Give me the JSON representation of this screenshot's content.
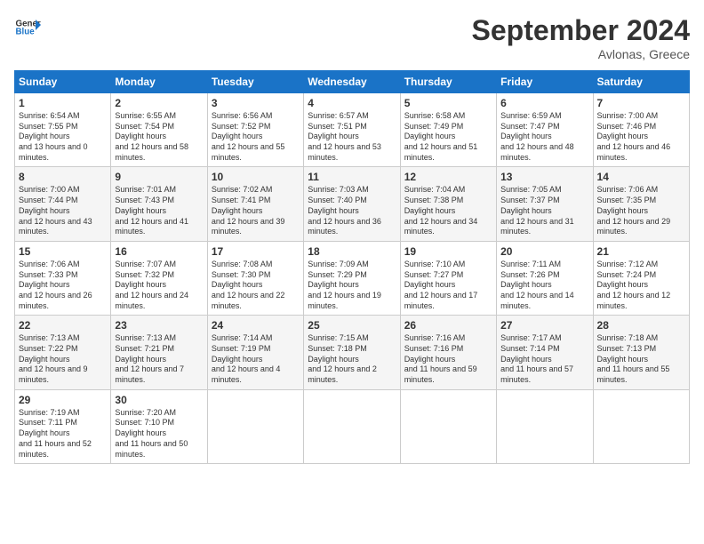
{
  "logo": {
    "text_general": "General",
    "text_blue": "Blue"
  },
  "header": {
    "month": "September 2024",
    "location": "Avlonas, Greece"
  },
  "weekdays": [
    "Sunday",
    "Monday",
    "Tuesday",
    "Wednesday",
    "Thursday",
    "Friday",
    "Saturday"
  ],
  "weeks": [
    [
      {
        "day": "1",
        "sunrise": "6:54 AM",
        "sunset": "7:55 PM",
        "daylight": "13 hours and 0 minutes."
      },
      {
        "day": "2",
        "sunrise": "6:55 AM",
        "sunset": "7:54 PM",
        "daylight": "12 hours and 58 minutes."
      },
      {
        "day": "3",
        "sunrise": "6:56 AM",
        "sunset": "7:52 PM",
        "daylight": "12 hours and 55 minutes."
      },
      {
        "day": "4",
        "sunrise": "6:57 AM",
        "sunset": "7:51 PM",
        "daylight": "12 hours and 53 minutes."
      },
      {
        "day": "5",
        "sunrise": "6:58 AM",
        "sunset": "7:49 PM",
        "daylight": "12 hours and 51 minutes."
      },
      {
        "day": "6",
        "sunrise": "6:59 AM",
        "sunset": "7:47 PM",
        "daylight": "12 hours and 48 minutes."
      },
      {
        "day": "7",
        "sunrise": "7:00 AM",
        "sunset": "7:46 PM",
        "daylight": "12 hours and 46 minutes."
      }
    ],
    [
      {
        "day": "8",
        "sunrise": "7:00 AM",
        "sunset": "7:44 PM",
        "daylight": "12 hours and 43 minutes."
      },
      {
        "day": "9",
        "sunrise": "7:01 AM",
        "sunset": "7:43 PM",
        "daylight": "12 hours and 41 minutes."
      },
      {
        "day": "10",
        "sunrise": "7:02 AM",
        "sunset": "7:41 PM",
        "daylight": "12 hours and 39 minutes."
      },
      {
        "day": "11",
        "sunrise": "7:03 AM",
        "sunset": "7:40 PM",
        "daylight": "12 hours and 36 minutes."
      },
      {
        "day": "12",
        "sunrise": "7:04 AM",
        "sunset": "7:38 PM",
        "daylight": "12 hours and 34 minutes."
      },
      {
        "day": "13",
        "sunrise": "7:05 AM",
        "sunset": "7:37 PM",
        "daylight": "12 hours and 31 minutes."
      },
      {
        "day": "14",
        "sunrise": "7:06 AM",
        "sunset": "7:35 PM",
        "daylight": "12 hours and 29 minutes."
      }
    ],
    [
      {
        "day": "15",
        "sunrise": "7:06 AM",
        "sunset": "7:33 PM",
        "daylight": "12 hours and 26 minutes."
      },
      {
        "day": "16",
        "sunrise": "7:07 AM",
        "sunset": "7:32 PM",
        "daylight": "12 hours and 24 minutes."
      },
      {
        "day": "17",
        "sunrise": "7:08 AM",
        "sunset": "7:30 PM",
        "daylight": "12 hours and 22 minutes."
      },
      {
        "day": "18",
        "sunrise": "7:09 AM",
        "sunset": "7:29 PM",
        "daylight": "12 hours and 19 minutes."
      },
      {
        "day": "19",
        "sunrise": "7:10 AM",
        "sunset": "7:27 PM",
        "daylight": "12 hours and 17 minutes."
      },
      {
        "day": "20",
        "sunrise": "7:11 AM",
        "sunset": "7:26 PM",
        "daylight": "12 hours and 14 minutes."
      },
      {
        "day": "21",
        "sunrise": "7:12 AM",
        "sunset": "7:24 PM",
        "daylight": "12 hours and 12 minutes."
      }
    ],
    [
      {
        "day": "22",
        "sunrise": "7:13 AM",
        "sunset": "7:22 PM",
        "daylight": "12 hours and 9 minutes."
      },
      {
        "day": "23",
        "sunrise": "7:13 AM",
        "sunset": "7:21 PM",
        "daylight": "12 hours and 7 minutes."
      },
      {
        "day": "24",
        "sunrise": "7:14 AM",
        "sunset": "7:19 PM",
        "daylight": "12 hours and 4 minutes."
      },
      {
        "day": "25",
        "sunrise": "7:15 AM",
        "sunset": "7:18 PM",
        "daylight": "12 hours and 2 minutes."
      },
      {
        "day": "26",
        "sunrise": "7:16 AM",
        "sunset": "7:16 PM",
        "daylight": "11 hours and 59 minutes."
      },
      {
        "day": "27",
        "sunrise": "7:17 AM",
        "sunset": "7:14 PM",
        "daylight": "11 hours and 57 minutes."
      },
      {
        "day": "28",
        "sunrise": "7:18 AM",
        "sunset": "7:13 PM",
        "daylight": "11 hours and 55 minutes."
      }
    ],
    [
      {
        "day": "29",
        "sunrise": "7:19 AM",
        "sunset": "7:11 PM",
        "daylight": "11 hours and 52 minutes."
      },
      {
        "day": "30",
        "sunrise": "7:20 AM",
        "sunset": "7:10 PM",
        "daylight": "11 hours and 50 minutes."
      },
      null,
      null,
      null,
      null,
      null
    ]
  ]
}
